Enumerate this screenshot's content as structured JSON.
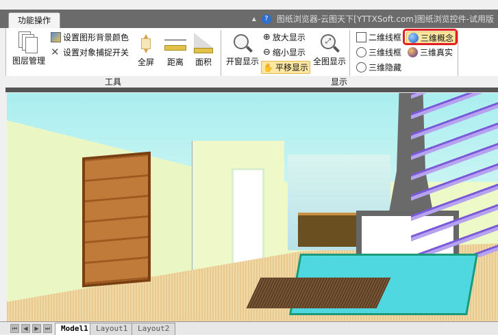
{
  "window": {
    "title": "图纸浏览器-云图天下[YTTXSoft.com]图纸浏览控件-试用版",
    "tab": "功能操作",
    "collapse": "▲",
    "help": "?"
  },
  "groups": {
    "tools": "工具",
    "display": "显示"
  },
  "tools": {
    "layers": "图层管理",
    "bg_color": "设置图形背景颜色",
    "snap": "设置对象捕捉开关",
    "fullscreen": "全屏",
    "distance": "距离",
    "area": "面积"
  },
  "display": {
    "window_zoom": "开窗显示",
    "zoom_in": "放大显示",
    "zoom_out": "缩小显示",
    "pan": "平移显示",
    "zoom_all": "全图显示"
  },
  "visual_styles": {
    "wire2d": "二维线框",
    "wire3d": "三维线框",
    "hidden3d": "三维隐藏",
    "conceptual3d": "三维概念",
    "realistic3d": "三维真实",
    "selected": "三维概念"
  },
  "layout_tabs": [
    "Model1",
    "Layout1",
    "Layout2"
  ],
  "nav_buttons": [
    "⏮",
    "◀",
    "▶",
    "⏭"
  ]
}
